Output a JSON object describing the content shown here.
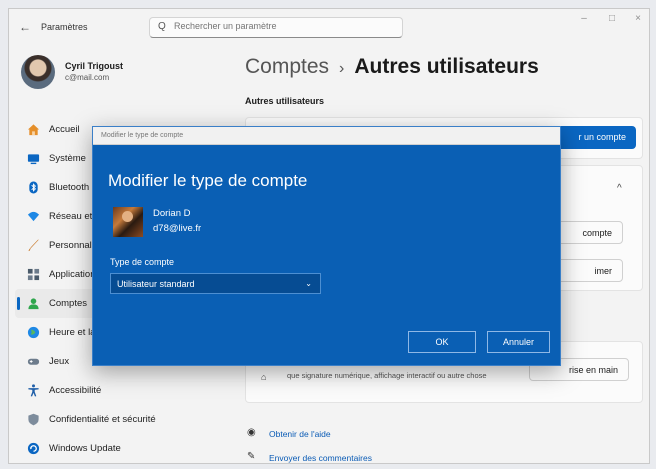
{
  "window": {
    "app_title": "Paramètres",
    "back_glyph": "←",
    "search_icon": "Q",
    "search_placeholder": "Rechercher un paramètre",
    "minimize_glyph": "–",
    "maximize_glyph": "□",
    "close_glyph": "×"
  },
  "profile": {
    "name": "Cyril Trigoust",
    "email": "c@mail.com"
  },
  "sidebar": {
    "items": [
      {
        "label": "Accueil",
        "icon": "home-icon",
        "color": "#e58f2a"
      },
      {
        "label": "Système",
        "icon": "system-icon",
        "color": "#0a66c2"
      },
      {
        "label": "Bluetooth et appareils",
        "icon": "bluetooth-icon",
        "color": "#0a66c2"
      },
      {
        "label": "Réseau et Internet",
        "icon": "network-icon",
        "color": "#1e88e5"
      },
      {
        "label": "Personnalisation",
        "icon": "brush-icon",
        "color": "#c97a2c"
      },
      {
        "label": "Applications",
        "icon": "apps-icon",
        "color": "#4a5a6a"
      },
      {
        "label": "Comptes",
        "icon": "accounts-icon",
        "color": "#2fa64d"
      },
      {
        "label": "Heure et langue",
        "icon": "globe-icon",
        "color": "#1e88e5"
      },
      {
        "label": "Jeux",
        "icon": "gamepad-icon",
        "color": "#6d7c8c"
      },
      {
        "label": "Accessibilité",
        "icon": "accessibility-icon",
        "color": "#1f5fa8"
      },
      {
        "label": "Confidentialité et sécurité",
        "icon": "shield-icon",
        "color": "#7d8c9c"
      },
      {
        "label": "Windows Update",
        "icon": "update-icon",
        "color": "#0a66c2"
      }
    ]
  },
  "main": {
    "breadcrumb_parent": "Comptes",
    "breadcrumb_separator": "›",
    "breadcrumb_current": "Autres utilisateurs",
    "section_heading": "Autres utilisateurs",
    "add_account_button": "r un compte",
    "chevron_up": "^",
    "change_type_button": "compte",
    "remove_button": "imer",
    "kiosk_description": "que signature numérique, affichage interactif ou autre chose",
    "kiosk_button": "rise en main",
    "help_link": "Obtenir de l'aide",
    "feedback_link": "Envoyer des commentaires"
  },
  "dialog": {
    "titlebar": "Modifier le type de compte",
    "heading": "Modifier le type de compte",
    "user_name": "Dorian D",
    "user_email": "d78@live.fr",
    "type_label": "Type de compte",
    "selected_type": "Utilisateur standard",
    "ok_button": "OK",
    "cancel_button": "Annuler"
  },
  "colors": {
    "accent": "#0a5fb4",
    "link": "#0a5bb5"
  }
}
